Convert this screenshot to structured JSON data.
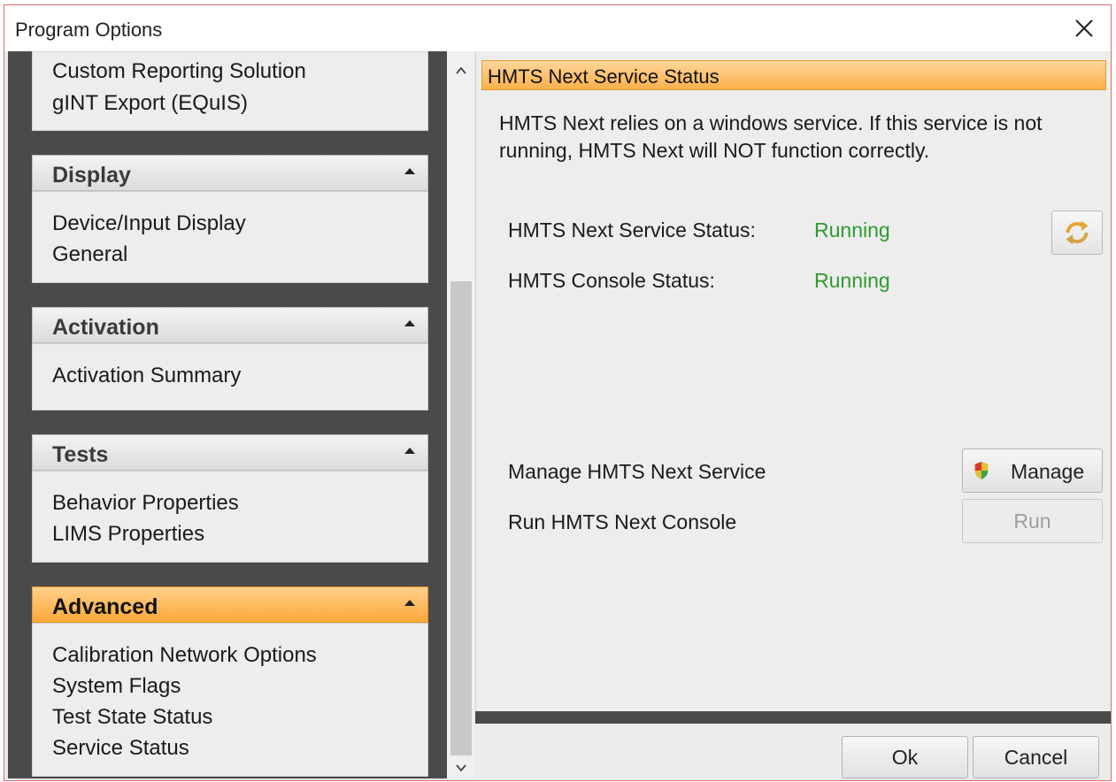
{
  "window": {
    "title": "Program Options"
  },
  "sidebar": {
    "top_items": [
      "Custom Reporting Solution",
      "gINT Export (EQuIS)"
    ],
    "groups": [
      {
        "label": "Display",
        "items": [
          "Device/Input Display",
          "General"
        ]
      },
      {
        "label": "Activation",
        "items": [
          "Activation Summary"
        ]
      },
      {
        "label": "Tests",
        "items": [
          "Behavior Properties",
          "LIMS Properties"
        ]
      },
      {
        "label": "Advanced",
        "items": [
          "Calibration Network Options",
          "System Flags",
          "Test State Status",
          "Service Status"
        ]
      }
    ]
  },
  "panel": {
    "header": "HMTS Next Service Status",
    "description": "HMTS Next relies on a windows service.  If this service is not running, HMTS Next will NOT function correctly.",
    "service_status_label": "HMTS Next Service Status:",
    "service_status_value": "Running",
    "console_status_label": "HMTS Console Status:",
    "console_status_value": "Running",
    "manage_label": "Manage HMTS Next Service",
    "manage_button": "Manage",
    "run_label": "Run HMTS Next Console",
    "run_button": "Run"
  },
  "footer": {
    "ok": "Ok",
    "cancel": "Cancel"
  },
  "colors": {
    "status_running": "#2e9a2e",
    "accent": "#fba838"
  }
}
